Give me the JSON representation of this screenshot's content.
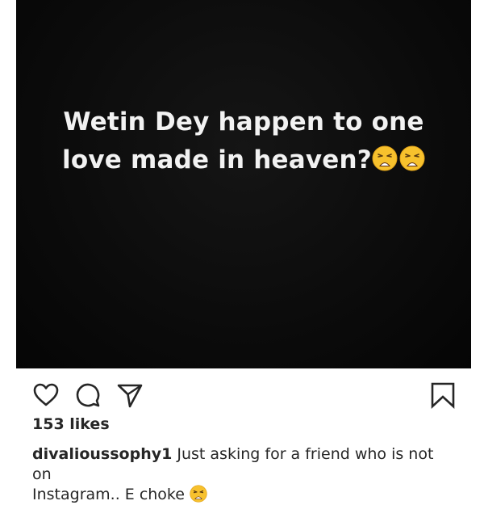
{
  "post": {
    "image_text": {
      "line1": "Wetin Dey happen to one",
      "line2": "love made in heaven?"
    },
    "image_emojis": [
      "weary-face",
      "weary-face"
    ]
  },
  "actions": {
    "like_icon": "heart-outline-icon",
    "comment_icon": "comment-bubble-icon",
    "share_icon": "paper-plane-icon",
    "save_icon": "bookmark-outline-icon"
  },
  "likes_text": "153 likes",
  "caption": {
    "username": "divalioussophy1",
    "text_line1": " Just asking for a friend who is not on",
    "text_line2": "Instagram.. E choke",
    "emoji": "weary-face"
  },
  "colors": {
    "image_background": "#0b0b0b",
    "image_text": "#f2f2f2",
    "text": "#262626",
    "emoji_face": "#f7c12d"
  }
}
